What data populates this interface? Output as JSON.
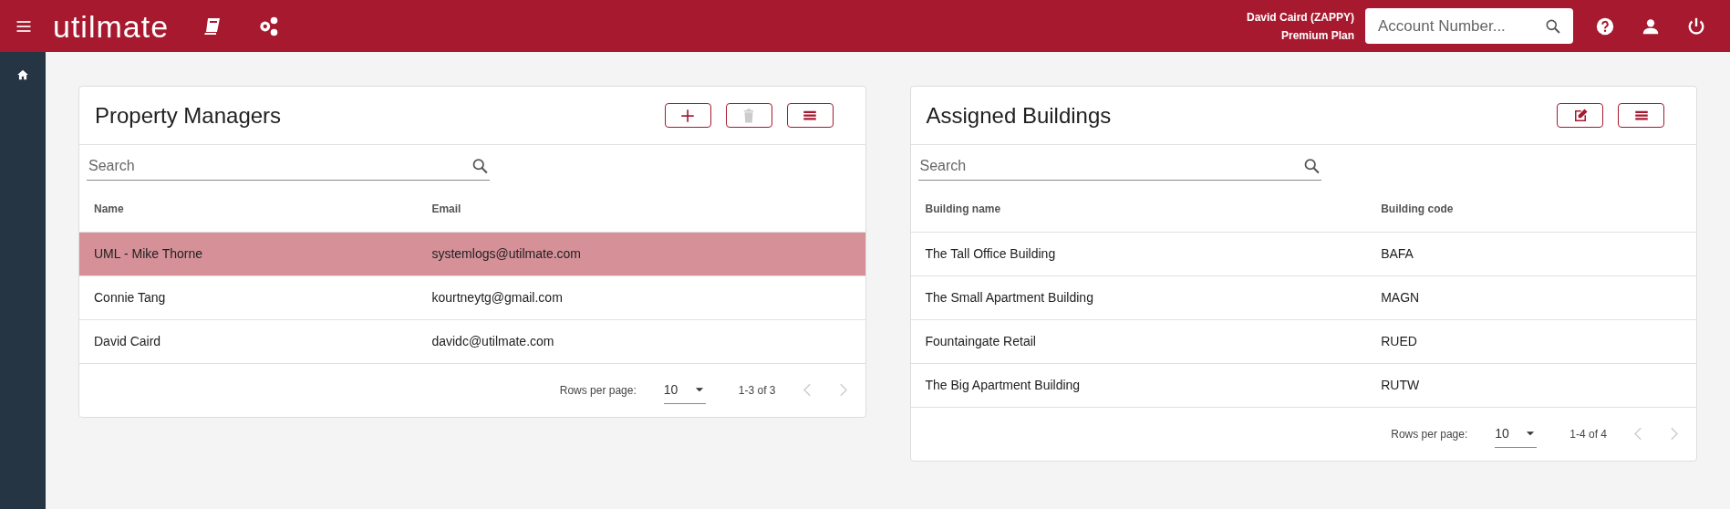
{
  "header": {
    "logo": "utilmate",
    "user_name": "David Caird (ZAPPY)",
    "plan": "Premium Plan",
    "account_search": {
      "placeholder": "Account Number..."
    }
  },
  "sidebar": {
    "items": [
      {
        "kind": "home",
        "selected": true
      }
    ]
  },
  "panels": [
    {
      "title": "Property Managers",
      "buttons": [
        {
          "kind": "add",
          "disabled": false
        },
        {
          "kind": "delete",
          "disabled": true
        },
        {
          "kind": "columns",
          "disabled": false
        }
      ],
      "search": {
        "placeholder": "Search"
      },
      "columns": [
        "Name",
        "Email"
      ],
      "rows": [
        {
          "cells": [
            "UML - Mike Thorne",
            "systemlogs@utilmate.com"
          ],
          "selected": true
        },
        {
          "cells": [
            "Connie Tang",
            "kourtneytg@gmail.com"
          ],
          "selected": false
        },
        {
          "cells": [
            "David Caird",
            "davidc@utilmate.com"
          ],
          "selected": false
        }
      ],
      "pagination": {
        "label": "Rows per page:",
        "rows_per_page": "10",
        "range": "1-3 of 3",
        "prev_disabled": true,
        "next_disabled": true
      }
    },
    {
      "title": "Assigned Buildings",
      "buttons": [
        {
          "kind": "edit",
          "disabled": false
        },
        {
          "kind": "columns",
          "disabled": false
        }
      ],
      "search": {
        "placeholder": "Search"
      },
      "columns": [
        "Building name",
        "Building code"
      ],
      "rows": [
        {
          "cells": [
            "The Tall Office Building",
            "BAFA"
          ],
          "selected": false
        },
        {
          "cells": [
            "The Small Apartment Building",
            "MAGN"
          ],
          "selected": false
        },
        {
          "cells": [
            "Fountaingate Retail",
            "RUED"
          ],
          "selected": false
        },
        {
          "cells": [
            "The Big Apartment Building",
            "RUTW"
          ],
          "selected": false
        }
      ],
      "pagination": {
        "label": "Rows per page:",
        "rows_per_page": "10",
        "range": "1-4 of 4",
        "prev_disabled": true,
        "next_disabled": true
      }
    }
  ]
}
